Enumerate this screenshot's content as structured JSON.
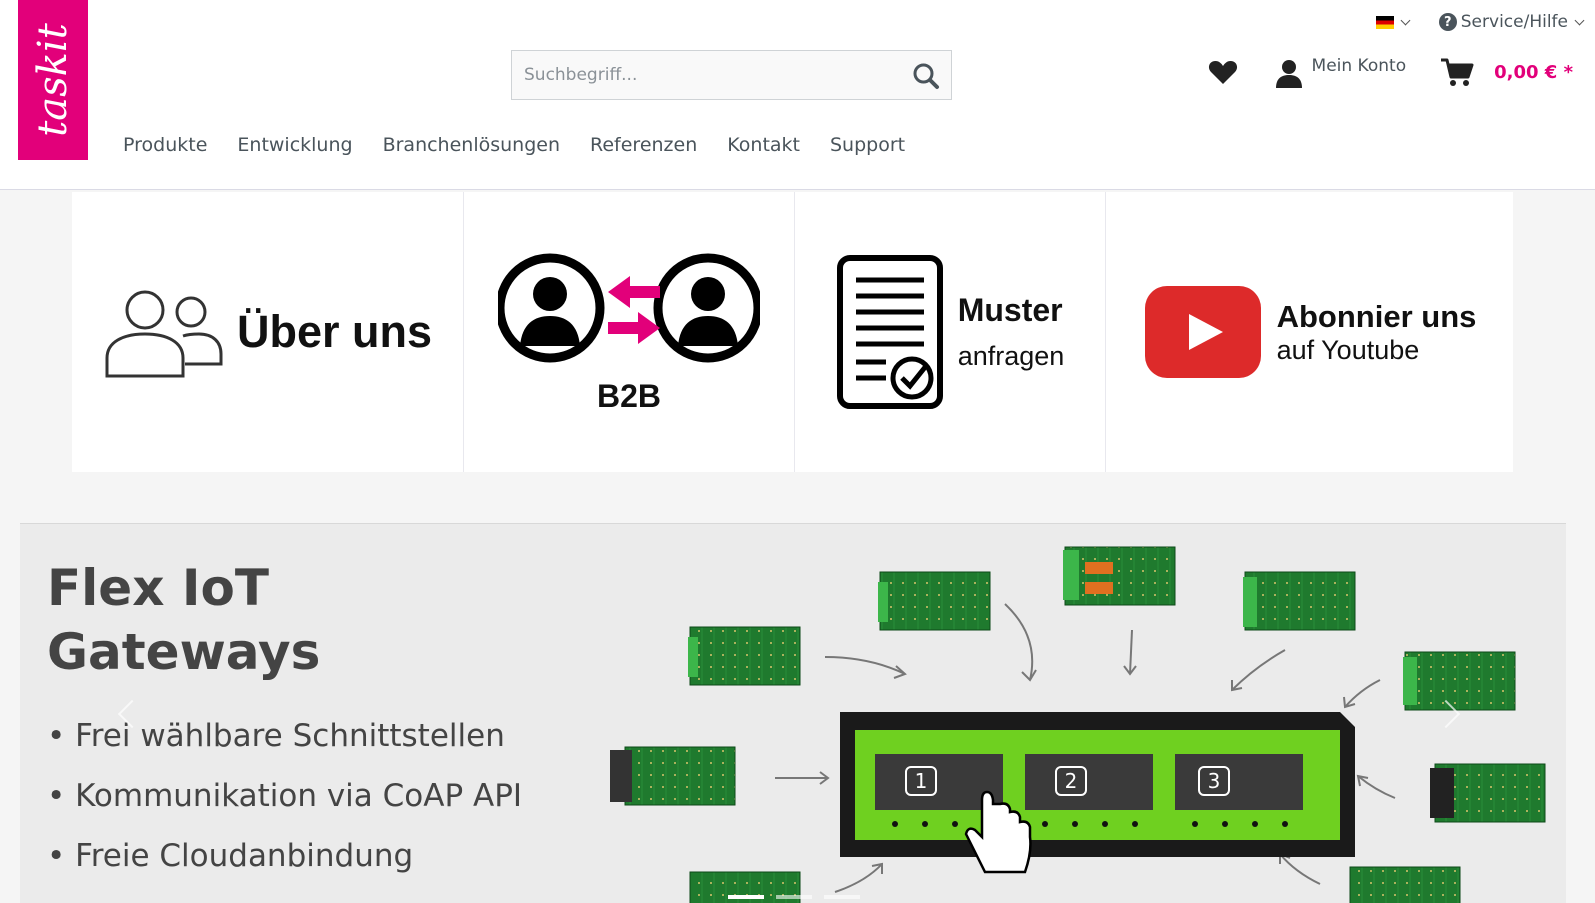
{
  "brand": {
    "logo_text": "taskit",
    "accent": "#e2007a"
  },
  "topbar": {
    "language": "DE",
    "service_label": "Service/Hilfe"
  },
  "search": {
    "placeholder": "Suchbegriff..."
  },
  "account": {
    "label": "Mein Konto"
  },
  "cart": {
    "amount": "0,00 € *"
  },
  "nav": {
    "items": [
      "Produkte",
      "Entwicklung",
      "Branchenlösungen",
      "Referenzen",
      "Kontakt",
      "Support"
    ]
  },
  "tiles": {
    "about": {
      "label": "Über uns"
    },
    "b2b": {
      "label": "B2B"
    },
    "sample": {
      "line1": "Muster",
      "line2": "anfragen"
    },
    "youtube": {
      "line1": "Abonnier uns",
      "line2": "auf Youtube"
    }
  },
  "slider": {
    "title": "Flex IoT Gateways",
    "bullets": [
      "• Frei wählbare Schnittstellen",
      "• Kommunikation via CoAP API",
      "• Freie Cloudanbindung"
    ],
    "slots": [
      "1",
      "2",
      "3"
    ],
    "active_slide": 1,
    "slide_count": 3
  },
  "colors": {
    "accent": "#e2007a",
    "youtube_red": "#dd2a2a",
    "board_green": "#1f7a2e",
    "gateway_green": "#6fd020"
  }
}
